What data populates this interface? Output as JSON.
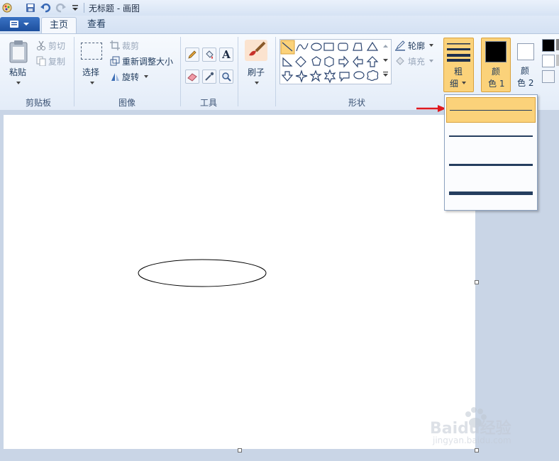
{
  "window": {
    "title": "无标题 - 画图"
  },
  "tabs": {
    "home": "主页",
    "view": "查看"
  },
  "clipboard": {
    "paste": "粘贴",
    "cut": "剪切",
    "copy": "复制",
    "group": "剪贴板"
  },
  "image": {
    "select": "选择",
    "crop": "裁剪",
    "resize": "重新调整大小",
    "rotate": "旋转",
    "group": "图像"
  },
  "tools": {
    "group": "工具",
    "text_tool": "A"
  },
  "brush": {
    "label": "刷子"
  },
  "shapes": {
    "outline": "轮廓",
    "fill": "填充",
    "group": "形状"
  },
  "size": {
    "line1": "粗",
    "line2": "细",
    "selected_option": 1
  },
  "colors": {
    "color1_a": "颜",
    "color1_b": "色 1",
    "color2_a": "颜",
    "color2_b": "色 2",
    "color1_value": "#000000",
    "color2_value": "#ffffff"
  },
  "accent": {
    "selection": "#fbd27a",
    "ribbon": "#dfe9f7",
    "arrow": "#e0191e"
  },
  "watermark": {
    "brand": "Baidu经验",
    "url": "jingyan.baidu.com"
  }
}
